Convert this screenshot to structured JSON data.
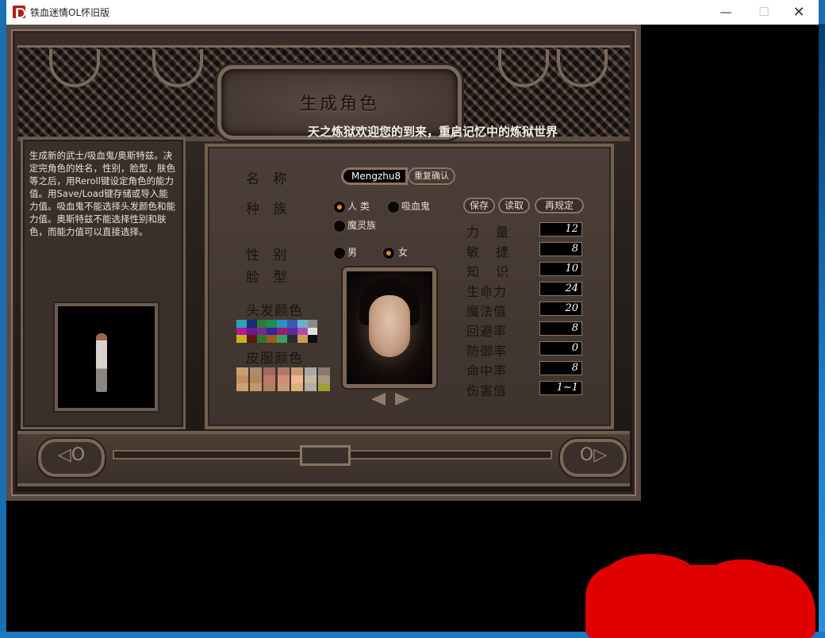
{
  "window": {
    "title": "铁血迷情OL怀旧版",
    "minimize_glyph": "—",
    "maximize_glyph": "☐",
    "close_glyph": "✕"
  },
  "screen": {
    "title": "生成角色",
    "welcome": "天之炼狱欢迎您的到来，重启记忆中的炼狱世界",
    "description": "生成新的武士/吸血鬼/奥斯特兹。决定完角色的姓名，性别，脸型，肤色等之后，用Reroll键设定角色的能力值。用Save/Load键存储或导入能力值。吸血鬼不能选择头发颜色和能力值。奥斯特兹不能选择性别和肤色，而能力值可以直接选择。"
  },
  "form": {
    "name_label": "名 称",
    "name_value": "Mengzhu8",
    "reconfirm_label": "重复确认",
    "race_label": "种 族",
    "races": [
      {
        "label": "人 类",
        "selected": true
      },
      {
        "label": "吸血鬼",
        "selected": false
      },
      {
        "label": "魔灵族",
        "selected": false
      }
    ],
    "gender_label": "性 别",
    "genders": [
      {
        "label": "男",
        "selected": false
      },
      {
        "label": "女",
        "selected": true
      }
    ],
    "face_label": "脸 型",
    "hair_color_label": "头发颜色",
    "skin_color_label": "皮服颜色"
  },
  "actions": {
    "save": "保存",
    "load": "读取",
    "reroll": "再规定"
  },
  "stats": [
    {
      "label": "力 量",
      "value": "12"
    },
    {
      "label": "敏 捷",
      "value": "8"
    },
    {
      "label": "知 识",
      "value": "10"
    },
    {
      "label": "生命力",
      "value": "24"
    },
    {
      "label": "魔法值",
      "value": "20"
    },
    {
      "label": "回避率",
      "value": "8"
    },
    {
      "label": "防御率",
      "value": "0"
    },
    {
      "label": "命中率",
      "value": "8"
    },
    {
      "label": "伤害值",
      "value": "1~1"
    }
  ],
  "nav": {
    "prev_glyph": "◁O",
    "next_glyph": "O▷"
  },
  "hair_colors": [
    "#2aa3b8",
    "#1a2a7a",
    "#2a7a3a",
    "#1f8f4f",
    "#2a8fc8",
    "#3a5ab0",
    "#6ab0d0",
    "#8a8a8a",
    "#b01aa0",
    "#6a1a8a",
    "#7a2a8a",
    "#2a2aa0",
    "#a01a6a",
    "#5a2aa0",
    "#b04ab0",
    "#e0e0e0",
    "#c8b020",
    "#5a1a10",
    "#2a7a2a",
    "#a05a1a",
    "#3aa060",
    "#2a2a2a",
    "#c8a050",
    "#101010"
  ],
  "skin_colors": [
    "#c8a070",
    "#b08a70",
    "#a06a60",
    "#b07a6a",
    "#c89a70",
    "#a8a8a8",
    "#8a7a6a",
    "#c09060",
    "#b08858",
    "#c07868",
    "#d09070",
    "#f0b890",
    "#c8b8a0",
    "#a89880",
    "#d0a070",
    "#c09870",
    "#b08060",
    "#c89878",
    "#e0b080",
    "#b0b0a0",
    "#a0a030"
  ]
}
